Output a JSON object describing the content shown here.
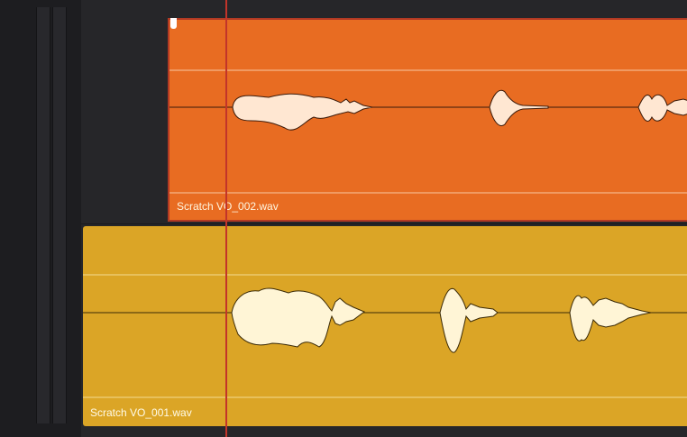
{
  "timeline": {
    "clips": [
      {
        "name": "Scratch VO_002.wav",
        "color": "#e86c22"
      },
      {
        "name": "Scratch VO_001.wav",
        "color": "#dba526"
      }
    ],
    "playhead_color": "#c2342a"
  }
}
